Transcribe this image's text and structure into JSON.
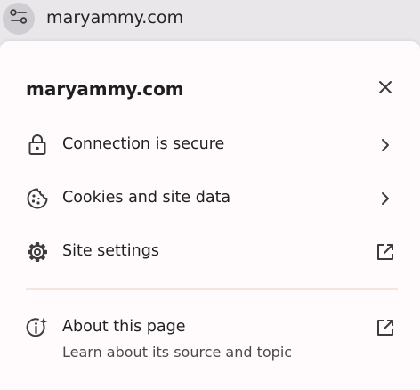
{
  "address_bar": {
    "url": "maryammy.com",
    "site_info_icon": "tune-icon"
  },
  "popup": {
    "title": "maryammy.com",
    "close_icon": "close-icon",
    "items": [
      {
        "label": "Connection is secure",
        "icon": "lock-icon",
        "trailing_icon": "chevron-right-icon"
      },
      {
        "label": "Cookies and site data",
        "icon": "cookie-icon",
        "trailing_icon": "chevron-right-icon"
      },
      {
        "label": "Site settings",
        "icon": "gear-icon",
        "trailing_icon": "open-in-new-icon"
      }
    ],
    "about": {
      "label": "About this page",
      "sublabel": "Learn about its source and topic",
      "icon": "info-sparkle-icon",
      "trailing_icon": "open-in-new-icon"
    }
  },
  "colors": {
    "toolbar_bg": "#e9e7ea",
    "popup_bg": "#fffbfd",
    "divider": "#f4e6dd",
    "icon": "#3c3c3c"
  }
}
